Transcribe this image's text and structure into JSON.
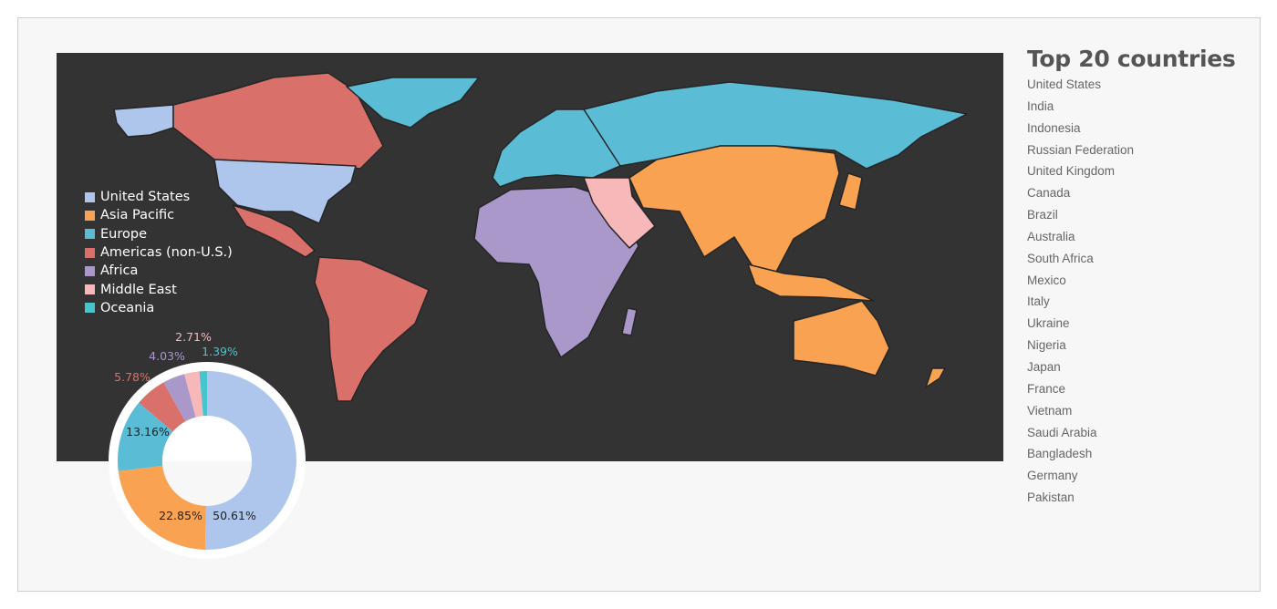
{
  "chart_data": {
    "type": "pie",
    "variant": "donut",
    "categories": [
      "United States",
      "Asia Pacific",
      "Europe",
      "Americas (non-U.S.)",
      "Africa",
      "Middle East",
      "Oceania"
    ],
    "values": [
      50.61,
      22.85,
      13.16,
      5.78,
      4.03,
      2.71,
      1.39
    ],
    "labels": [
      "50.61%",
      "22.85%",
      "13.16%",
      "5.78%",
      "4.03%",
      "2.71%",
      "1.39%"
    ],
    "colors": [
      "#aec6eb",
      "#f9a352",
      "#5bbcd6",
      "#d9706a",
      "#a998c9",
      "#f6b8b8",
      "#47c5cf"
    ],
    "legend_placement": "left, over map"
  },
  "map": {
    "background": "#333333",
    "border_color": "#222222"
  },
  "top_countries": {
    "title": "Top 20 countries",
    "items": [
      "United States",
      "India",
      "Indonesia",
      "Russian Federation",
      "United Kingdom",
      "Canada",
      "Brazil",
      "Australia",
      "South Africa",
      "Mexico",
      "Italy",
      "Ukraine",
      "Nigeria",
      "Japan",
      "France",
      "Vietnam",
      "Saudi Arabia",
      "Bangladesh",
      "Germany",
      "Pakistan"
    ]
  }
}
